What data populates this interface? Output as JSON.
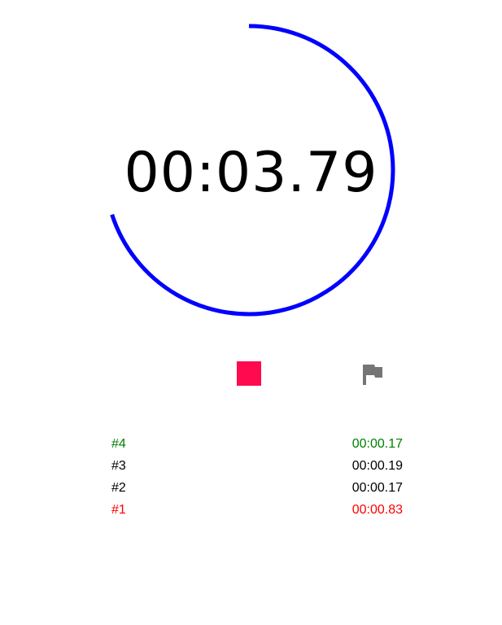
{
  "stopwatch": {
    "elapsed": "00:03.79",
    "progress": 0.7,
    "ring_color": "#0000ff"
  },
  "controls": {
    "stop_icon": "stop-icon",
    "stop_color": "#ff0a4f",
    "lap_icon": "flag-icon",
    "lap_color": "#757575"
  },
  "laps": [
    {
      "label": "#4",
      "time": "00:00.17",
      "color": "#008000"
    },
    {
      "label": "#3",
      "time": "00:00.19",
      "color": "#000000"
    },
    {
      "label": "#2",
      "time": "00:00.17",
      "color": "#000000"
    },
    {
      "label": "#1",
      "time": "00:00.83",
      "color": "#ff0000"
    }
  ]
}
